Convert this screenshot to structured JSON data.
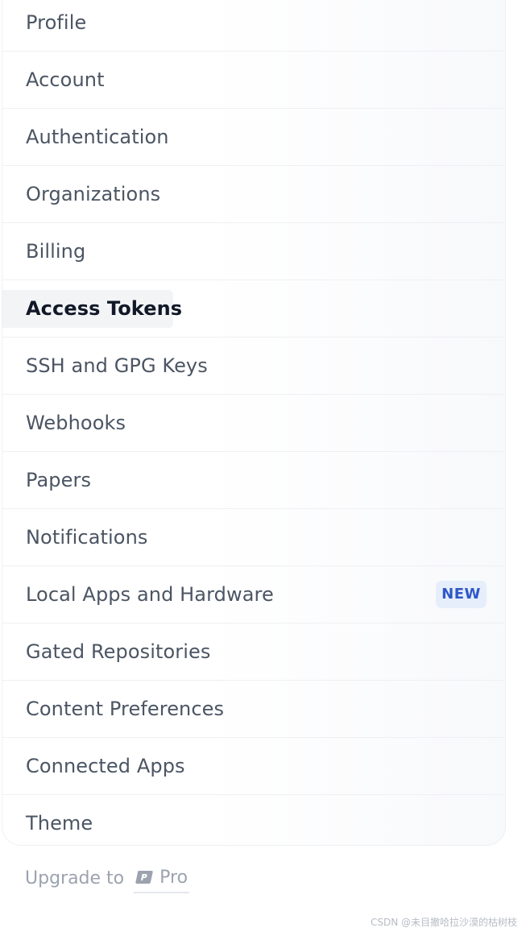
{
  "menu": {
    "items": [
      {
        "label": "Profile"
      },
      {
        "label": "Account"
      },
      {
        "label": "Authentication"
      },
      {
        "label": "Organizations"
      },
      {
        "label": "Billing"
      },
      {
        "label": "Access Tokens",
        "active": true
      },
      {
        "label": "SSH and GPG Keys"
      },
      {
        "label": "Webhooks"
      },
      {
        "label": "Papers"
      },
      {
        "label": "Notifications"
      },
      {
        "label": "Local Apps and Hardware",
        "badge": "NEW"
      },
      {
        "label": "Gated Repositories"
      },
      {
        "label": "Content Preferences"
      },
      {
        "label": "Connected Apps"
      },
      {
        "label": "Theme"
      }
    ]
  },
  "upgrade": {
    "text": "Upgrade to",
    "pro_label": "Pro",
    "pro_icon": "pro-badge-icon"
  },
  "watermark": "CSDN @未目撤哈拉沙漠的枯树枝",
  "colors": {
    "active_text": "#111827",
    "text": "#4b5563",
    "badge_bg": "#e6eefc",
    "badge_text": "#2f57c7",
    "muted": "#9ca3af"
  }
}
